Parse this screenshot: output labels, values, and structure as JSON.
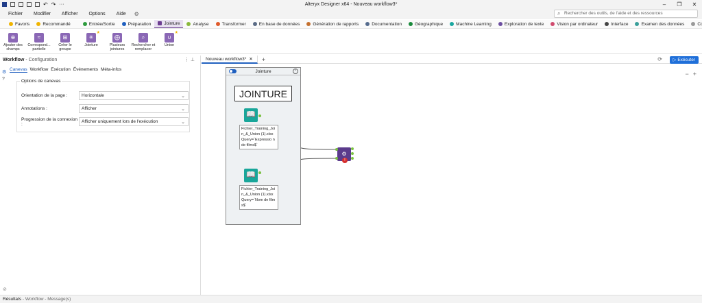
{
  "window": {
    "title": "Alteryx Designer x64 - Nouveau workflow3*"
  },
  "menu": [
    "Fichier",
    "Modifier",
    "Afficher",
    "Options",
    "Aide"
  ],
  "search": {
    "placeholder": "Rechercher des outils, de l'aide et des ressources"
  },
  "categories": [
    {
      "label": "Favoris",
      "color": "#f0b400"
    },
    {
      "label": "Recommandé",
      "color": "#f0b400"
    },
    {
      "label": "Entrée/Sortie",
      "color": "#2e9c3e"
    },
    {
      "label": "Préparation",
      "color": "#1f5fbf"
    },
    {
      "label": "Jointure",
      "color": "#6c3d91"
    },
    {
      "label": "Analyse",
      "color": "#8ab83c"
    },
    {
      "label": "Transformer",
      "color": "#e05a2b"
    },
    {
      "label": "En base de données",
      "color": "#5a6b85"
    },
    {
      "label": "Génération de rapports",
      "color": "#c4702e"
    },
    {
      "label": "Documentation",
      "color": "#556b8d"
    },
    {
      "label": "Géographique",
      "color": "#1a8a3c"
    },
    {
      "label": "Machine Learning",
      "color": "#1aa7a0"
    },
    {
      "label": "Exploration de texte",
      "color": "#6d4fa0"
    },
    {
      "label": "Vision par ordinateur",
      "color": "#d04a6e"
    },
    {
      "label": "Interface",
      "color": "#444444"
    },
    {
      "label": "Examen des données",
      "color": "#3a9f9a"
    },
    {
      "label": "Conne",
      "color": "#999999"
    }
  ],
  "tools": [
    {
      "label": "Ajouter des champs",
      "starred": false
    },
    {
      "label": "Correspond... partielle",
      "starred": false
    },
    {
      "label": "Créer le groupe",
      "starred": false
    },
    {
      "label": "Jointure",
      "starred": true
    },
    {
      "label": "Plusieurs jointures",
      "starred": false
    },
    {
      "label": "Rechercher et remplacer",
      "starred": false
    },
    {
      "label": "Union",
      "starred": true
    }
  ],
  "config": {
    "title": "Workflow",
    "subtitle": "- Configuration",
    "tabs": [
      "Canevas",
      "Workflow",
      "Exécution",
      "Événements",
      "Méta-infos"
    ],
    "group_title": "Options de canevas",
    "rows": [
      {
        "label": "Orientation de la page :",
        "value": "Horizontale"
      },
      {
        "label": "Annotations :",
        "value": "Afficher"
      },
      {
        "label": "Progression de la connexion :",
        "value": "Afficher uniquement lors de l'exécution"
      }
    ]
  },
  "canvas": {
    "tab_label": "Nouveau workflow3*",
    "run_label": "Exécuter",
    "container_title": "Jointure",
    "comment_text": "JOINTURE",
    "input1_annotation": "Fichier_Training_Join_&_Union (1).xlsx Query=`Expressio n de films$`",
    "input2_annotation": "Fichier_Training_Join_&_Union (1).xlsx Query=`Nom de films$`",
    "error_badge": "!"
  },
  "status": {
    "title": "Résultats",
    "subtitle": "- Workflow - Message(s)"
  }
}
